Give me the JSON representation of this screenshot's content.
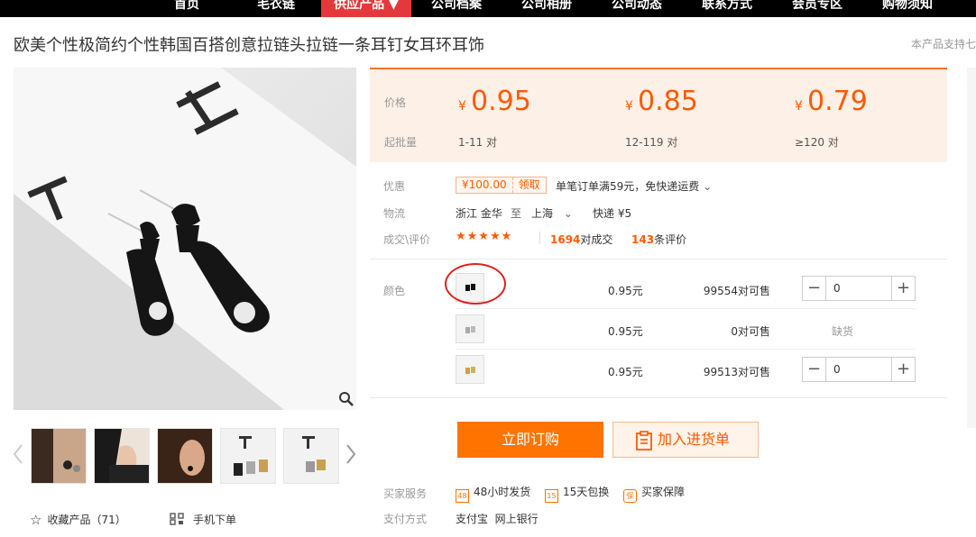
{
  "nav": {
    "items": [
      "首页",
      "毛衣链",
      "供应产品 ▼",
      "公司档案",
      "公司相册",
      "公司动态",
      "联系方式",
      "会员专区",
      "购物须知"
    ]
  },
  "product": {
    "title": "欧美个性极简约个性韩国百搭创意拉链头拉链一条耳钉女耳环耳饰",
    "side_note": "本产品支持七"
  },
  "price_box": {
    "price_label": "价格",
    "qty_label": "起批量",
    "currency": "¥",
    "tiers": [
      {
        "price": "0.95",
        "range": "1-11 对"
      },
      {
        "price": "0.85",
        "range": "12-119 对"
      },
      {
        "price": "0.79",
        "range": "≥120 对"
      }
    ]
  },
  "promo": {
    "label": "优惠",
    "coupon_amount": "¥100.00",
    "coupon_action": "领取",
    "desc": "单笔订单满59元，免快递运费"
  },
  "logistics": {
    "label": "物流",
    "from": "浙江 金华",
    "to_word": "至",
    "to": "上海",
    "fee": "快递 ¥5"
  },
  "deals": {
    "label": "成交\\评价",
    "stars": "★★★★★",
    "deal_count": "1694",
    "deal_unit": "对成交",
    "review_count": "143",
    "review_unit": "条评价"
  },
  "sku": {
    "label": "颜色",
    "rows": [
      {
        "price": "0.95元",
        "stock": "99554对可售",
        "qty": "0",
        "status": ""
      },
      {
        "price": "0.95元",
        "stock": "0对可售",
        "qty": "",
        "status": "缺货"
      },
      {
        "price": "0.95元",
        "stock": "99513对可售",
        "qty": "0",
        "status": ""
      }
    ]
  },
  "actions": {
    "buy": "立即订购",
    "cart": "加入进货单"
  },
  "services": {
    "label": "买家服务",
    "items": [
      {
        "icon": "48h-icon",
        "glyph": "48",
        "text": "48小时发货"
      },
      {
        "icon": "15day-icon",
        "glyph": "15",
        "text": "15天包换"
      },
      {
        "icon": "guarantee-icon",
        "glyph": "保",
        "text": "买家保障"
      }
    ]
  },
  "payment": {
    "label": "支付方式",
    "methods": "支付宝  网上银行"
  },
  "gallery": {
    "favorite": "收藏产品（71）",
    "mobile": "手机下单"
  },
  "colors": {
    "accent": "#ff7300",
    "price": "#ff5a00",
    "nav_active": "#e4393c",
    "highlight": "#e02020"
  }
}
